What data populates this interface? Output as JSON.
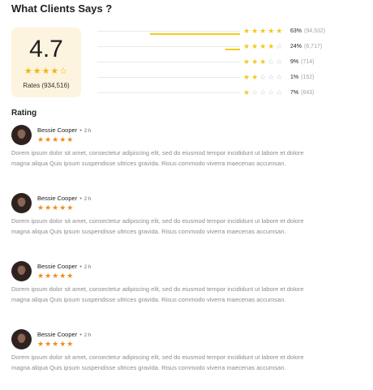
{
  "header": {
    "title": "What Clients Says ?"
  },
  "summary": {
    "average": "4.7",
    "stars": "★★★★☆",
    "rates_label": "Rates (934,516)"
  },
  "distribution": [
    {
      "stars_on": "★★★★★",
      "stars_off": "",
      "percent": "63%",
      "count": "(94,532)",
      "fill": 0.63
    },
    {
      "stars_on": "★★★★",
      "stars_off": "☆",
      "percent": "24%",
      "count": "(6,717)",
      "fill": 0.1
    },
    {
      "stars_on": "★★★",
      "stars_off": "☆☆",
      "percent": "9%",
      "count": "(714)",
      "fill": 0
    },
    {
      "stars_on": "★★",
      "stars_off": "☆☆☆",
      "percent": "1%",
      "count": "(152)",
      "fill": 0
    },
    {
      "stars_on": "★",
      "stars_off": "☆☆☆☆",
      "percent": "7%",
      "count": "(643)",
      "fill": 0
    }
  ],
  "section": {
    "label": "Rating"
  },
  "reviews": [
    {
      "name": "Bessie Cooper",
      "time": "2 h",
      "stars": "★★★★★",
      "text": "Dorem ipsum dolor sit amet, consectetur adipiscing elit, sed do eiusmod tempor incididunt ut labore et dolore magna aliqua Quis ipsum suspendisse ultrices gravida. Risus commodo viverra maecenas accumsan."
    },
    {
      "name": "Bessie Cooper",
      "time": "2 h",
      "stars": "★★★★★",
      "text": "Dorem ipsum dolor sit amet, consectetur adipiscing elit, sed do eiusmod tempor incididunt ut labore et dolore magna aliqua Quis ipsum suspendisse ultrices gravida. Risus commodo viverra maecenas accumsan."
    },
    {
      "name": "Bessie Cooper",
      "time": "2 h",
      "stars": "★★★★★",
      "text": "Dorem ipsum dolor sit amet, consectetur adipiscing elit, sed do eiusmod tempor incididunt ut labore et dolore magna aliqua Quis ipsum suspendisse ultrices gravida. Risus commodo viverra maecenas accumsan."
    },
    {
      "name": "Bessie Cooper",
      "time": "2 h",
      "stars": "★★★★★",
      "text": "Dorem ipsum dolor sit amet, consectetur adipiscing elit, sed do eiusmod tempor incididunt ut labore et dolore magna aliqua Quis ipsum suspendisse ultrices gravida. Risus commodo viverra maecenas accumsan."
    }
  ],
  "colors": {
    "accent": "#f2c91b",
    "review_star": "#f08a1c",
    "card_bg": "#fdf4df"
  }
}
